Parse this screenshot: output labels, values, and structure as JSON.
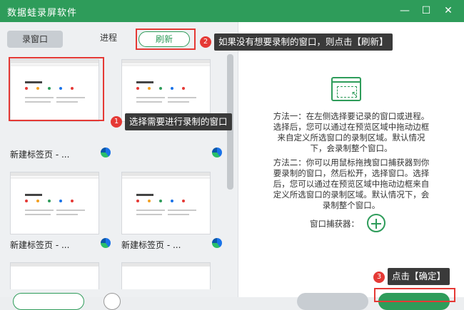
{
  "app": {
    "title": "数据蛙录屏软件"
  },
  "window_controls": {
    "minimize": "—",
    "maximize": "☐",
    "close": "✕"
  },
  "tabs": [
    {
      "label": "录窗口",
      "active": true
    },
    {
      "label": "进程",
      "active": false
    }
  ],
  "refresh_label": "刷新",
  "windows": [
    {
      "label": "",
      "browser_icon": "edge-icon"
    },
    {
      "label": "",
      "browser_icon": "edge-icon"
    },
    {
      "label": "新建标签页 - ...",
      "browser_icon": "edge-icon"
    },
    {
      "label": "",
      "browser_icon": "edge-icon"
    },
    {
      "label": "新建标签页 - ...",
      "browser_icon": "edge-icon"
    },
    {
      "label": "新建标签页 - ...",
      "browser_icon": "edge-icon"
    }
  ],
  "right": {
    "method1": [
      "方法一：在左侧选择要记录的窗口或进程。",
      "选择后，您可以通过在预览区域中拖动边框",
      "来自定义所选窗口的录制区域。默认情况",
      "下，会录制整个窗口。"
    ],
    "method2": [
      "方法二：你可以用鼠标拖拽窗口捕获器到你",
      "要录制的窗口，然后松开，选择窗口。选择",
      "后，您可以通过在预览区域中拖动边框来自",
      "定义所选窗口的录制区域。默认情况下，会",
      "录制整个窗口。"
    ],
    "catcher_label": "窗口捕获器："
  },
  "callouts": [
    {
      "num": "1",
      "text": "选择需要进行录制的窗口"
    },
    {
      "num": "2",
      "text": "如果没有想要录制的窗口，则点击【刷新】"
    },
    {
      "num": "3",
      "text": "点击【确定】"
    }
  ],
  "colors": {
    "accent": "#2e9c5a",
    "highlight": "#e53935",
    "tip_bg": "#3a3a3a"
  }
}
